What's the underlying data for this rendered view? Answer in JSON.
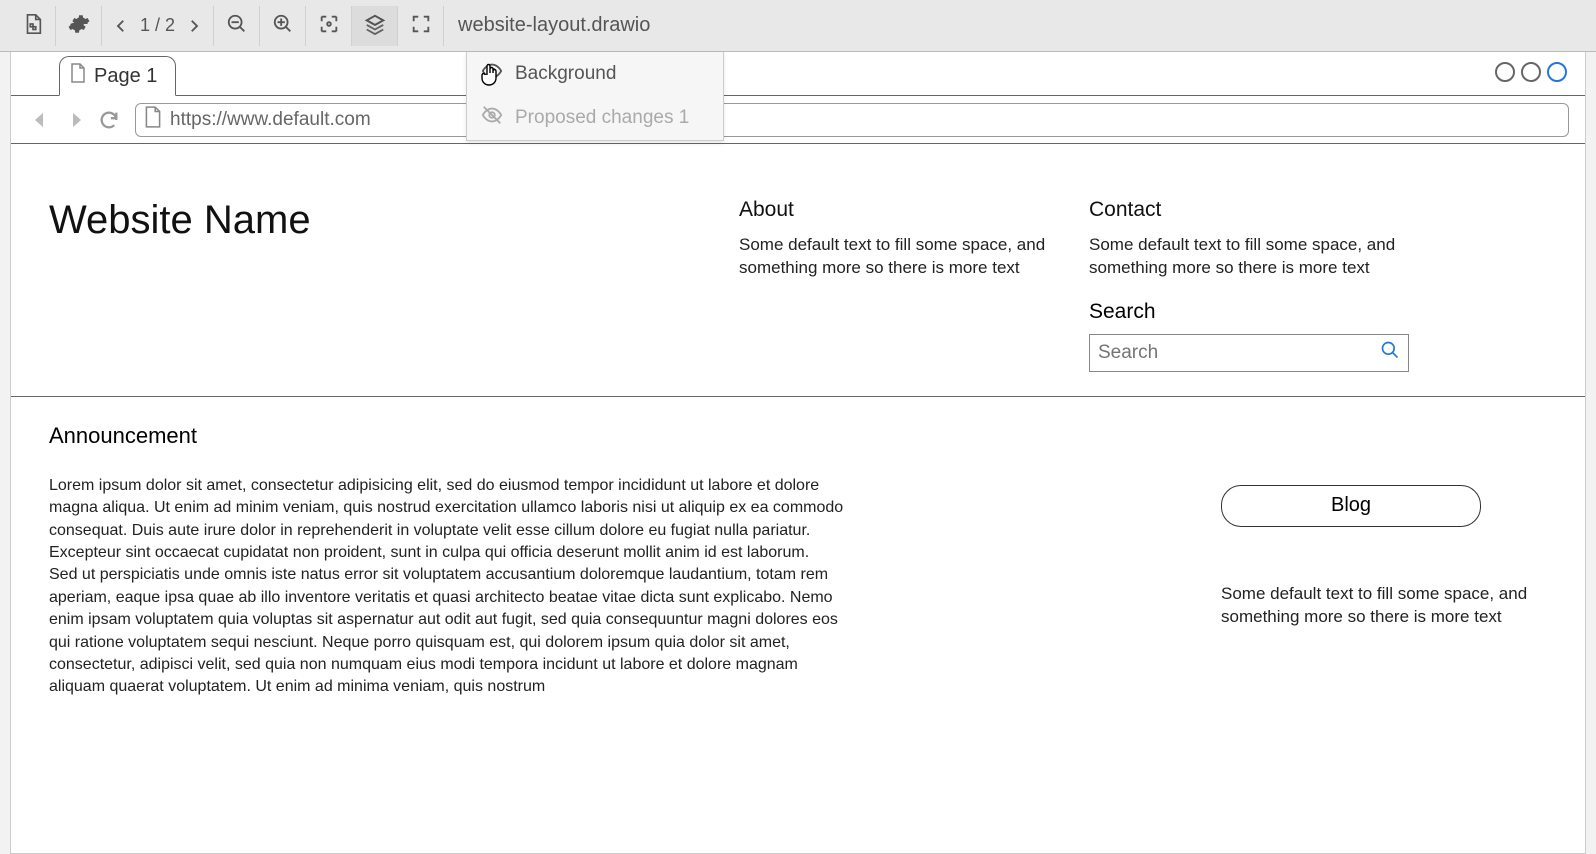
{
  "toolbar": {
    "page_current": "1",
    "page_total": "2",
    "page_display": "1 / 2",
    "filename": "website-layout.drawio"
  },
  "layers": {
    "item1": "Background",
    "item2": "Proposed changes 1"
  },
  "tab": {
    "label": "Page 1"
  },
  "browser": {
    "url": "https://www.default.com"
  },
  "mockup": {
    "site_name": "Website Name",
    "about": {
      "title": "About",
      "text": "Some default text to fill some space, and something more so there is more text"
    },
    "contact": {
      "title": "Contact",
      "text": "Some default text to fill some space, and something more so there is more text"
    },
    "search": {
      "label": "Search",
      "placeholder": "Search"
    },
    "announcement": {
      "title": "Announcement",
      "body": "Lorem ipsum dolor sit amet, consectetur adipisicing elit, sed do eiusmod tempor incididunt ut labore et dolore magna aliqua. Ut enim ad minim veniam, quis nostrud exercitation ullamco laboris nisi ut aliquip ex ea commodo consequat. Duis aute irure dolor in reprehenderit in voluptate velit esse cillum dolore eu fugiat nulla pariatur. Excepteur sint occaecat cupidatat non proident, sunt in culpa qui officia deserunt mollit anim id est laborum.\nSed ut perspiciatis unde omnis iste natus error sit voluptatem accusantium doloremque laudantium, totam rem aperiam, eaque ipsa quae ab illo inventore veritatis et quasi architecto beatae vitae dicta sunt explicabo. Nemo enim ipsam voluptatem quia voluptas sit aspernatur aut odit aut fugit, sed quia consequuntur magni dolores eos qui ratione voluptatem sequi nesciunt. Neque porro quisquam est, qui dolorem ipsum quia dolor sit amet, consectetur, adipisci velit, sed quia non numquam eius modi tempora incidunt ut labore et dolore magnam aliquam quaerat voluptatem. Ut enim ad minima veniam, quis nostrum"
    },
    "blog": {
      "button": "Blog",
      "text": "Some default text to fill some space, and something more so there is more text"
    }
  }
}
